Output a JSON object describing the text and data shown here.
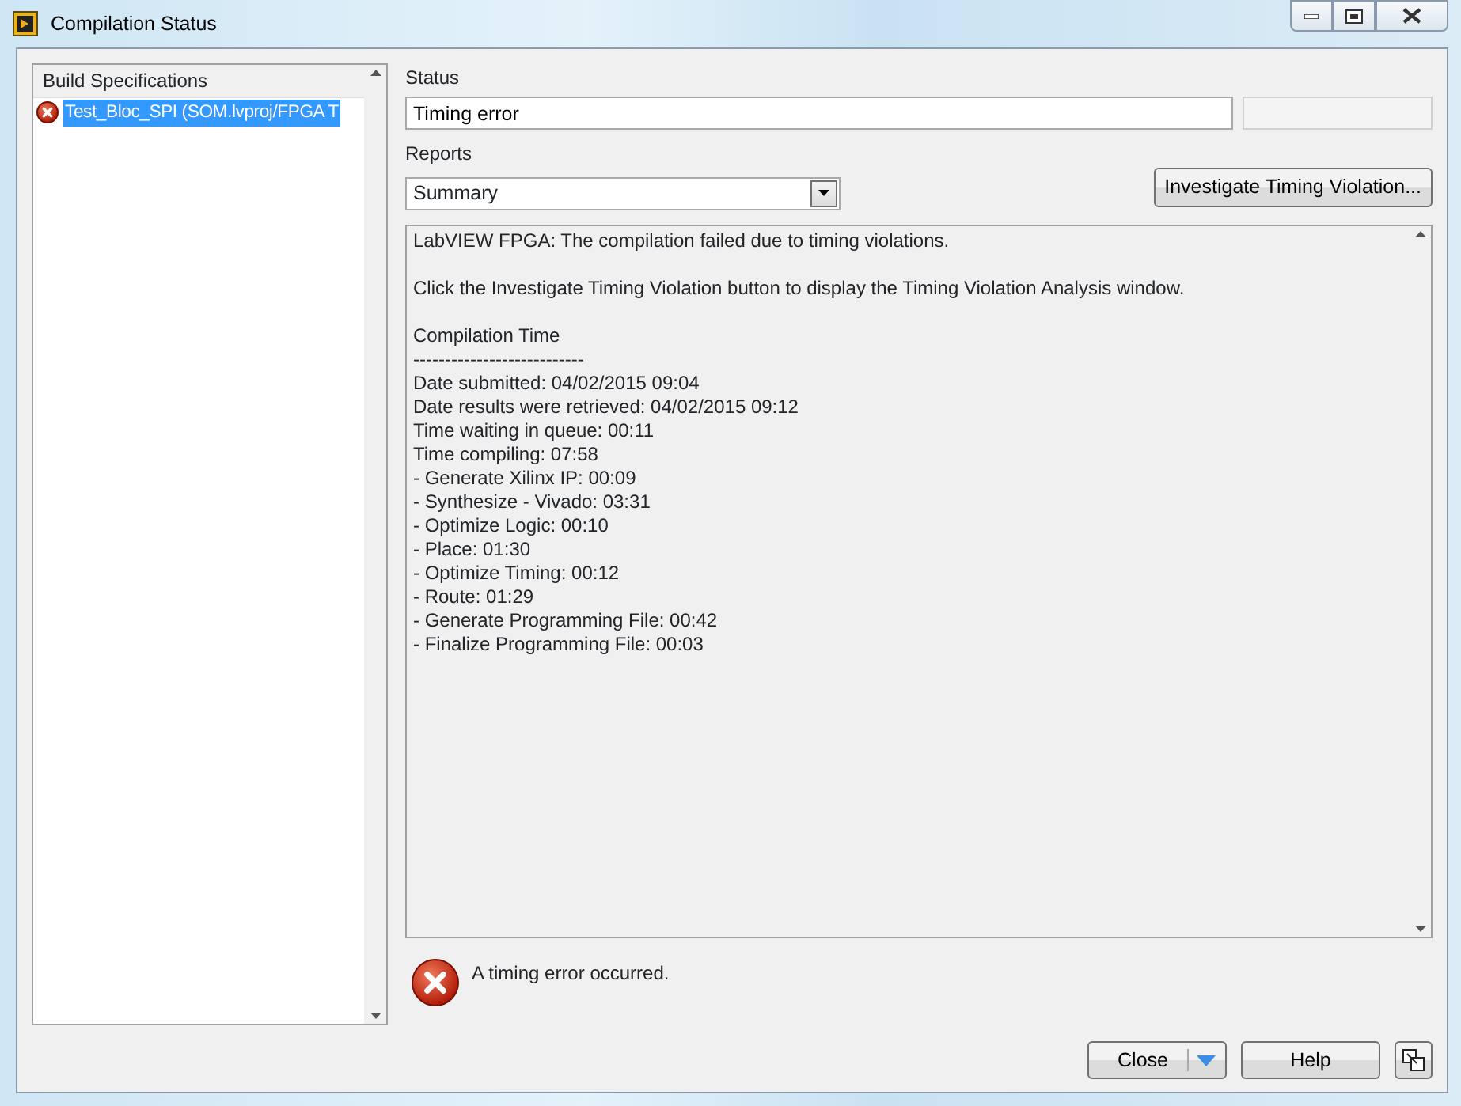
{
  "window": {
    "title": "Compilation Status"
  },
  "build_specifications": {
    "header": "Build Specifications",
    "items": [
      {
        "label": "Test_Bloc_SPI (SOM.lvproj/FPGA T",
        "kind": "error",
        "selected": true
      }
    ]
  },
  "status": {
    "label": "Status",
    "value": "Timing error"
  },
  "reports": {
    "label": "Reports",
    "value": "Summary"
  },
  "investigate_button": "Investigate Timing Violation...",
  "report_paragraphs": [
    [
      "LabVIEW FPGA:  The compilation failed due to timing violations."
    ],
    [
      "Click the Investigate Timing Violation button to display the Timing Violation Analysis window."
    ],
    [
      "Compilation Time",
      "---------------------------",
      "Date submitted: 04/02/2015 09:04",
      "Date results were retrieved: 04/02/2015 09:12",
      "Time waiting in queue: 00:11",
      "Time compiling: 07:58",
      "- Generate Xilinx IP: 00:09",
      "- Synthesize - Vivado: 03:31",
      "- Optimize Logic: 00:10",
      "- Place: 01:30",
      "- Optimize Timing: 00:12",
      "- Route: 01:29",
      "- Generate Programming File: 00:42",
      "- Finalize Programming File: 00:03"
    ]
  ],
  "message": {
    "kind": "error",
    "text": "A timing error occurred."
  },
  "buttons": [
    "Close",
    "Help"
  ]
}
